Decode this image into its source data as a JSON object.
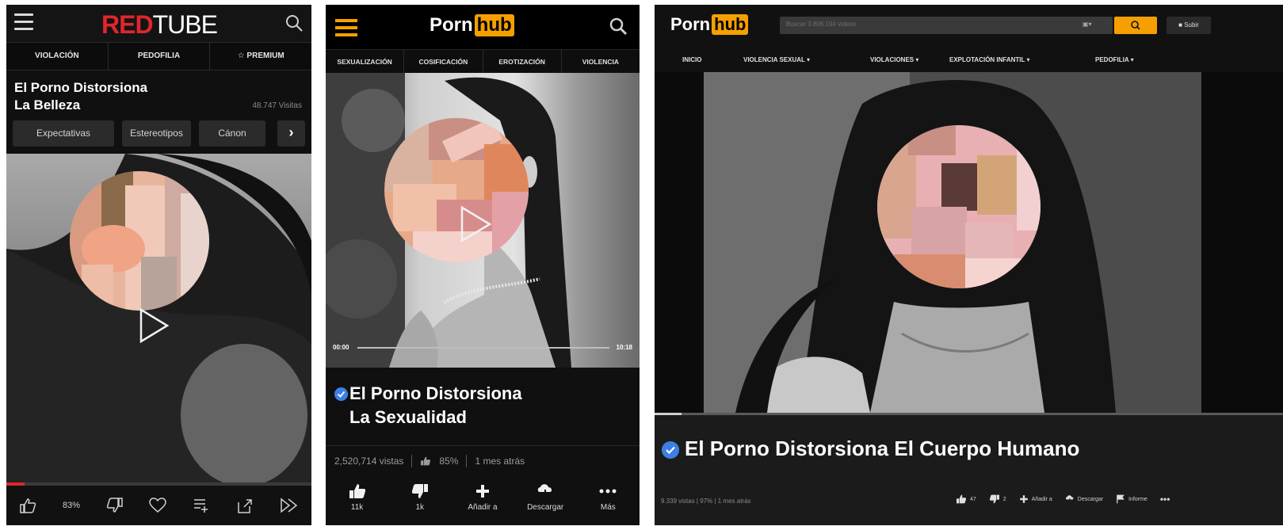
{
  "redtube": {
    "logo_red": "RED",
    "logo_white": "TUBE",
    "nav": [
      "VIOLACIÓN",
      "PEDOFILIA",
      "☆ PREMIUM"
    ],
    "title_line1": "El Porno Distorsiona",
    "title_line2": "La Belleza",
    "views": "48.747 Visitas",
    "tags": [
      "Expectativas",
      "Estereotipos",
      "Cánon"
    ],
    "next_arrow": "›",
    "rating": "83%",
    "progress": 0.06,
    "icons": [
      "menu-icon",
      "search-icon",
      "thumbs-up-icon",
      "thumbs-down-icon",
      "heart-icon",
      "add-to-playlist-icon",
      "share-icon",
      "next-icon"
    ]
  },
  "pornhub_mobile": {
    "logo_porn": "Porn",
    "logo_hub": "hub",
    "nav": [
      "SEXUALIZACIÓN",
      "COSIFICACIÓN",
      "EROTIZACIÓN",
      "VIOLENCIA"
    ],
    "time_current": "00:00",
    "time_total": "10:18",
    "title_line1": "El Porno Distorsiona",
    "title_line2": "La Sexualidad",
    "views": "2,520,714 vistas",
    "rating": "85%",
    "age": "1 mes atrás",
    "actions": [
      {
        "icon": "thumbs-up-icon",
        "label": "11k"
      },
      {
        "icon": "thumbs-down-icon",
        "label": "1k"
      },
      {
        "icon": "plus-icon",
        "label": "Añadir a"
      },
      {
        "icon": "download-icon",
        "label": "Descargar"
      },
      {
        "icon": "more-icon",
        "label": "Más"
      }
    ],
    "accent": "#f5a000",
    "verified_color": "#3d7fe3"
  },
  "pornhub_desktop": {
    "logo_porn": "Porn",
    "logo_hub": "hub",
    "search_placeholder": "Buscar 3.806.194 videos",
    "upload_label": "Subir",
    "nav": [
      "INICIO",
      "VIOLENCIA SEXUAL ▾",
      "VIOLACIONES ▾",
      "EXPLOTACIÓN INFANTIL ▾",
      "PEDOFILIA ▾"
    ],
    "title": "El Porno Distorsiona El Cuerpo Humano",
    "stats": "9.339 vistas | 97% | 1 mes atrás",
    "actions": [
      {
        "icon": "thumbs-up-icon",
        "label": "47"
      },
      {
        "icon": "thumbs-down-icon",
        "label": "2"
      },
      {
        "icon": "plus-icon",
        "label": "Añadir a"
      },
      {
        "icon": "download-icon",
        "label": "Descargar"
      },
      {
        "icon": "flag-icon",
        "label": "Informe"
      },
      {
        "icon": "more-icon",
        "label": "•••"
      }
    ]
  }
}
